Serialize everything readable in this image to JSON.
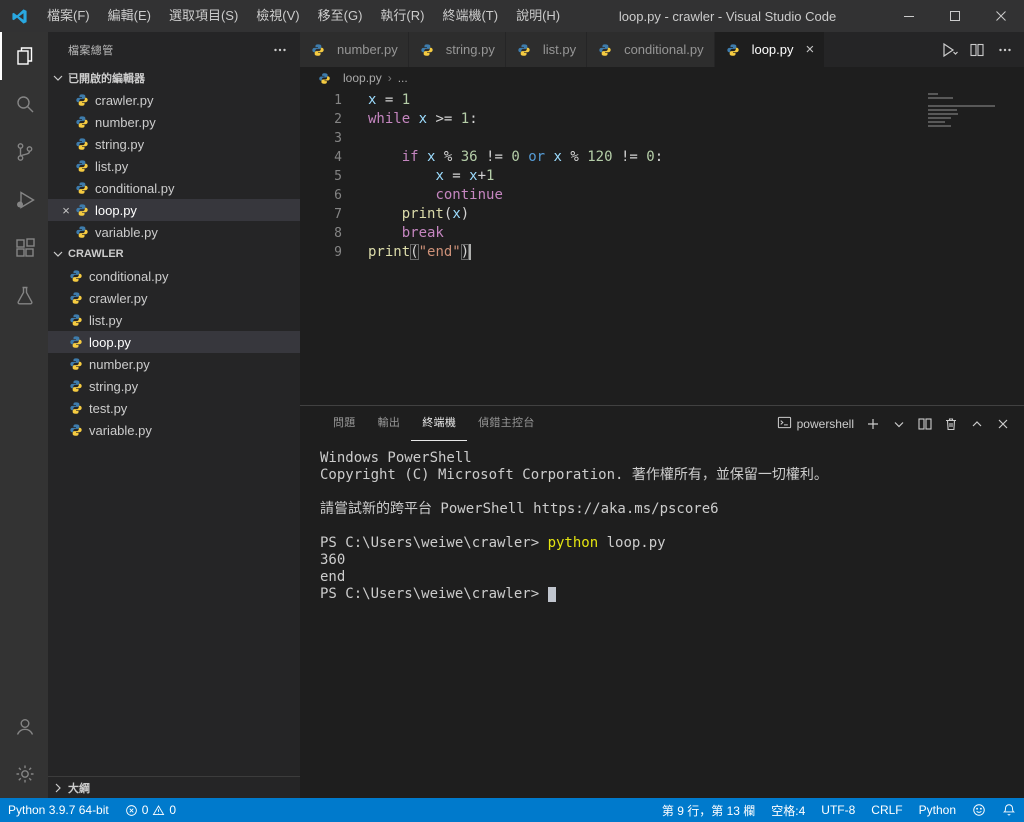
{
  "colors": {
    "statusbar_bg": "#007ACC",
    "titlebar_bg": "#323233",
    "activitybar_bg": "#333333",
    "sidebar_bg": "#252526",
    "editor_bg": "#1E1E1E",
    "tab_inactive_bg": "#2D2D2D",
    "row_highlight": "#37373D",
    "keyword": "#C586C0",
    "keyword_operator": "#569CD6",
    "variable": "#9CDCFE",
    "number": "#B5CEA8",
    "function": "#DCDCAA",
    "string": "#CE9178",
    "plain": "#D4D4D4",
    "terminal_command": "#E5E510"
  },
  "title_bar": {
    "menus": [
      "檔案(F)",
      "編輯(E)",
      "選取項目(S)",
      "檢視(V)",
      "移至(G)",
      "執行(R)",
      "終端機(T)",
      "說明(H)"
    ],
    "title": "loop.py - crawler - Visual Studio Code"
  },
  "sidebar": {
    "header": "檔案總管",
    "open_editors": {
      "label": "已開啟的編輯器",
      "items": [
        {
          "name": "crawler.py"
        },
        {
          "name": "number.py"
        },
        {
          "name": "string.py"
        },
        {
          "name": "list.py"
        },
        {
          "name": "conditional.py"
        },
        {
          "name": "loop.py",
          "active": true
        },
        {
          "name": "variable.py"
        }
      ]
    },
    "folder": {
      "label": "CRAWLER",
      "items": [
        {
          "name": "conditional.py"
        },
        {
          "name": "crawler.py"
        },
        {
          "name": "list.py"
        },
        {
          "name": "loop.py",
          "selected": true
        },
        {
          "name": "number.py"
        },
        {
          "name": "string.py"
        },
        {
          "name": "test.py"
        },
        {
          "name": "variable.py"
        }
      ]
    },
    "outline": {
      "label": "大綱"
    }
  },
  "editor_tabs": [
    {
      "label": "number.py"
    },
    {
      "label": "string.py"
    },
    {
      "label": "list.py"
    },
    {
      "label": "conditional.py"
    },
    {
      "label": "loop.py",
      "active": true
    }
  ],
  "breadcrumb": {
    "file": "loop.py",
    "symbol": "..."
  },
  "code": {
    "lines": [
      {
        "n": "1",
        "tokens": [
          [
            "v",
            "x"
          ],
          [
            "p",
            " = "
          ],
          [
            "n",
            "1"
          ]
        ]
      },
      {
        "n": "2",
        "tokens": [
          [
            "k",
            "while"
          ],
          [
            "p",
            " "
          ],
          [
            "v",
            "x"
          ],
          [
            "p",
            " >= "
          ],
          [
            "n",
            "1"
          ],
          [
            "p",
            ":"
          ]
        ]
      },
      {
        "n": "3",
        "tokens": []
      },
      {
        "n": "4",
        "tokens": [
          [
            "p",
            "    "
          ],
          [
            "k",
            "if"
          ],
          [
            "p",
            " "
          ],
          [
            "v",
            "x"
          ],
          [
            "p",
            " % "
          ],
          [
            "n",
            "36"
          ],
          [
            "p",
            " != "
          ],
          [
            "n",
            "0"
          ],
          [
            "p",
            " "
          ],
          [
            "b",
            "or"
          ],
          [
            "p",
            " "
          ],
          [
            "v",
            "x"
          ],
          [
            "p",
            " % "
          ],
          [
            "n",
            "120"
          ],
          [
            "p",
            " != "
          ],
          [
            "n",
            "0"
          ],
          [
            "p",
            ":"
          ]
        ]
      },
      {
        "n": "5",
        "tokens": [
          [
            "p",
            "        "
          ],
          [
            "v",
            "x"
          ],
          [
            "p",
            " = "
          ],
          [
            "v",
            "x"
          ],
          [
            "p",
            "+"
          ],
          [
            "n",
            "1"
          ]
        ]
      },
      {
        "n": "6",
        "tokens": [
          [
            "p",
            "        "
          ],
          [
            "k",
            "continue"
          ]
        ]
      },
      {
        "n": "7",
        "tokens": [
          [
            "p",
            "    "
          ],
          [
            "f",
            "print"
          ],
          [
            "p",
            "("
          ],
          [
            "v",
            "x"
          ],
          [
            "p",
            ")"
          ]
        ]
      },
      {
        "n": "8",
        "tokens": [
          [
            "p",
            "    "
          ],
          [
            "k",
            "break"
          ]
        ]
      },
      {
        "n": "9",
        "tokens": [
          [
            "f",
            "print"
          ],
          [
            "x",
            "("
          ],
          [
            "s",
            "\"end\""
          ],
          [
            "x",
            ")"
          ]
        ],
        "cursor": true
      }
    ]
  },
  "panel": {
    "tabs": [
      {
        "label": "問題"
      },
      {
        "label": "輸出"
      },
      {
        "label": "終端機",
        "active": true
      },
      {
        "label": "偵錯主控台"
      }
    ],
    "shell_label": "powershell",
    "terminal": {
      "lines": [
        [
          [
            "t",
            "Windows PowerShell"
          ]
        ],
        [
          [
            "t",
            "Copyright (C) Microsoft Corporation. 著作權所有，並保留一切權利。"
          ]
        ],
        [],
        [
          [
            "t",
            "請嘗試新的跨平台 PowerShell https://aka.ms/pscore6"
          ]
        ],
        [],
        [
          [
            "t",
            "PS C:\\Users\\weiwe\\crawler> "
          ],
          [
            "y",
            "python"
          ],
          [
            "t",
            " loop.py"
          ]
        ],
        [
          [
            "t",
            "360"
          ]
        ],
        [
          [
            "t",
            "end"
          ]
        ],
        [
          [
            "t",
            "PS C:\\Users\\weiwe\\crawler> "
          ],
          [
            "c",
            ""
          ]
        ]
      ]
    }
  },
  "status_bar": {
    "python_version": "Python 3.9.7 64-bit",
    "errors": "0",
    "warnings": "0",
    "cursor_position": "第 9 行，第 13 欄",
    "indent": "空格:4",
    "encoding": "UTF-8",
    "eol": "CRLF",
    "language": "Python"
  }
}
